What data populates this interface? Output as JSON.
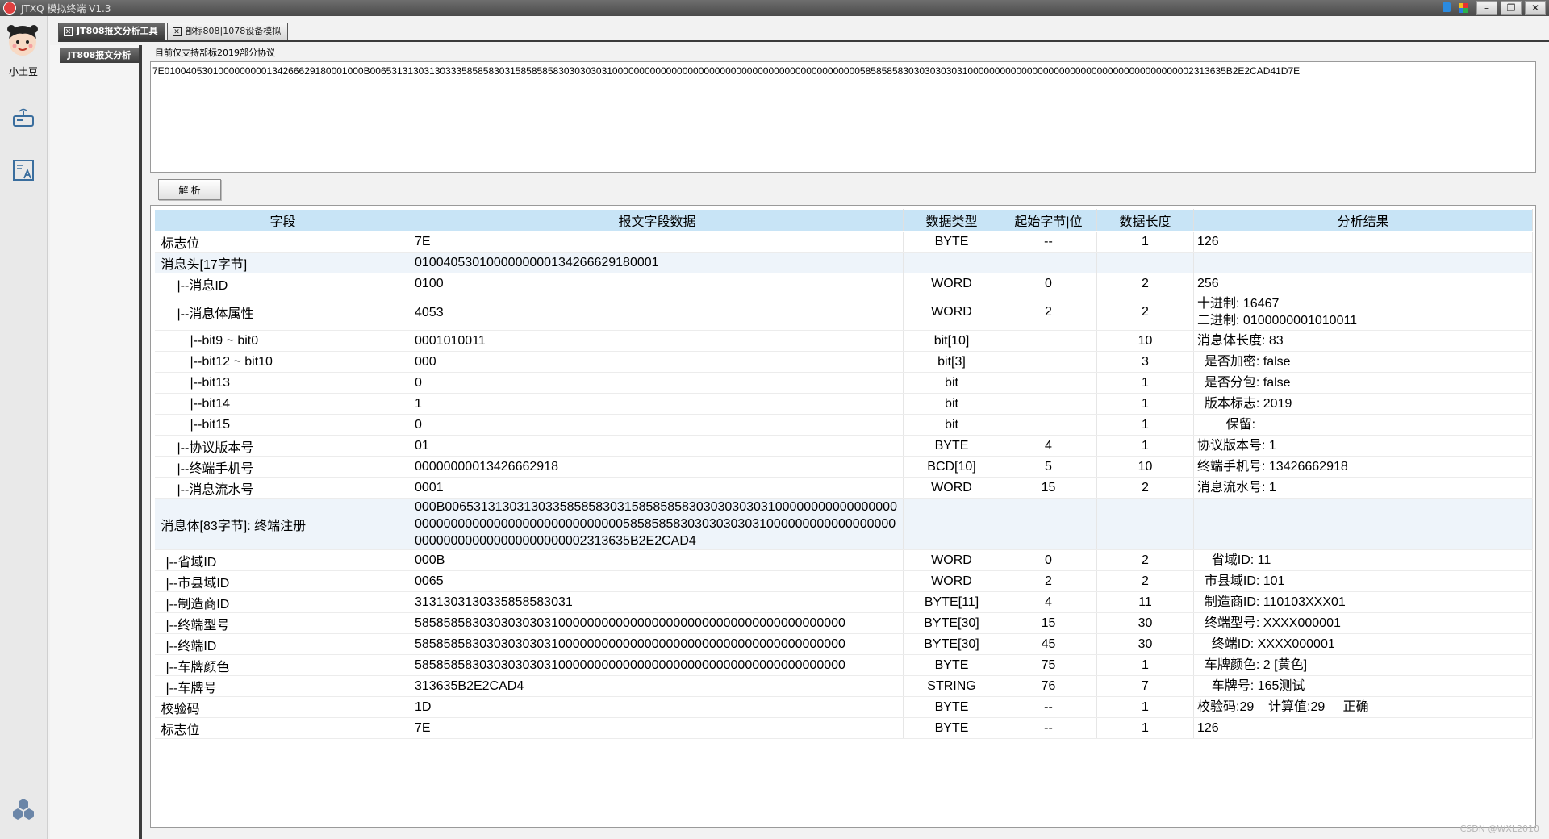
{
  "window": {
    "title": "JTXQ 模拟终端 V1.3",
    "buttons": [
      "–",
      "❐",
      "✕"
    ]
  },
  "leftnav": {
    "avatar_name": "小土豆"
  },
  "tabs": [
    {
      "label": "JT808报文分析工具",
      "active": true
    },
    {
      "label": "部标808|1078设备模拟",
      "active": false
    }
  ],
  "subpanel": {
    "tab_label": "JT808报文分析"
  },
  "main": {
    "hint": "目前仅支持部标2019部分协议",
    "hex_input": "7E0100405301000000000134266629180001000B006531313031303335858583031585858583030303031000000000000000000000000000000000000000000000058585858303030303031000000000000000000000000000000000000000002313635B2E2CAD41D7E",
    "parse_button": "解  析"
  },
  "table": {
    "headers": [
      "字段",
      "报文字段数据",
      "数据类型",
      "起始字节|位",
      "数据长度",
      "分析结果"
    ],
    "rows": [
      {
        "field": "标志位",
        "data": "7E",
        "type": "BYTE",
        "start": "--",
        "len": "1",
        "result": [
          "126"
        ]
      },
      {
        "field": "消息头[17字节]",
        "data": "010040530100000000013426662918000​1",
        "type": "",
        "start": "",
        "len": "",
        "result": [],
        "section": true
      },
      {
        "field": "|--消息ID",
        "data": "0100",
        "type": "WORD",
        "start": "0",
        "len": "2",
        "result": [
          "256"
        ],
        "indent": 1
      },
      {
        "field": "|--消息体属性",
        "data": "4053",
        "type": "WORD",
        "start": "2",
        "len": "2",
        "result": [
          "十进制: 16467",
          "二进制: 0100000001010011"
        ],
        "indent": 1,
        "tall": true
      },
      {
        "field": "|--bit9 ~ bit0",
        "data": "0001010011",
        "type": "bit[10]",
        "start": "",
        "len": "10",
        "result": [
          "消息体长度: 83"
        ],
        "indent": 2
      },
      {
        "field": "|--bit12 ~ bit10",
        "data": "000",
        "type": "bit[3]",
        "start": "",
        "len": "3",
        "result": [
          "  是否加密: false"
        ],
        "indent": 2
      },
      {
        "field": "|--bit13",
        "data": "0",
        "type": "bit",
        "start": "",
        "len": "1",
        "result": [
          "  是否分包: false"
        ],
        "indent": 2
      },
      {
        "field": "|--bit14",
        "data": "1",
        "type": "bit",
        "start": "",
        "len": "1",
        "result": [
          "  版本标志: 2019"
        ],
        "indent": 2
      },
      {
        "field": "|--bit15",
        "data": "0",
        "type": "bit",
        "start": "",
        "len": "1",
        "result": [
          "        保留:"
        ],
        "indent": 2
      },
      {
        "field": "|--协议版本号",
        "data": "01",
        "type": "BYTE",
        "start": "4",
        "len": "1",
        "result": [
          "协议版本号: 1"
        ],
        "indent": 1
      },
      {
        "field": "|--终端手机号",
        "data": "00000000013426662918",
        "type": "BCD[10]",
        "start": "5",
        "len": "10",
        "result": [
          "终端手机号: 13426662918"
        ],
        "indent": 1
      },
      {
        "field": "|--消息流水号",
        "data": "0001",
        "type": "WORD",
        "start": "15",
        "len": "2",
        "result": [
          "消息流水号: 1"
        ],
        "indent": 1
      },
      {
        "field": "消息体[83字节]: 终端注册",
        "data": "000B0065313130313033585858303158585858303030303031000000000000000000000000000000000000000000000058585858303030303031000000000000000000000000000000000000000002313635B2E2CAD4",
        "type": "",
        "start": "",
        "len": "",
        "result": [],
        "section": true,
        "tall": true
      },
      {
        "field": "|--省域ID",
        "data": "000B",
        "type": "WORD",
        "start": "0",
        "len": "2",
        "result": [
          "    省域ID: 11"
        ],
        "indent": 0
      },
      {
        "field": "|--市县域ID",
        "data": "0065",
        "type": "WORD",
        "start": "2",
        "len": "2",
        "result": [
          "  市县域ID: 101"
        ],
        "indent": 0
      },
      {
        "field": "|--制造商ID",
        "data": "3131303130335858583031",
        "type": "BYTE[11]",
        "start": "4",
        "len": "11",
        "result": [
          "  制造商ID: 110103XXX01"
        ],
        "indent": 0
      },
      {
        "field": "|--终端型号",
        "data": "585858583030303030310000000000000000000000000000000000000000",
        "type": "BYTE[30]",
        "start": "15",
        "len": "30",
        "result": [
          "  终端型号: XXXX000001"
        ],
        "indent": 0
      },
      {
        "field": "|--终端ID",
        "data": "585858583030303030310000000000000000000000000000000000000000",
        "type": "BYTE[30]",
        "start": "45",
        "len": "30",
        "result": [
          "    终端ID: XXXX000001"
        ],
        "indent": 0
      },
      {
        "field": "|--车牌颜色",
        "data": "585858583030303030310000000000000000000000000000000000000000",
        "type": "BYTE",
        "start": "75",
        "len": "1",
        "result": [
          "  车牌颜色: 2 [黄色]"
        ],
        "indent": 0
      },
      {
        "field": "|--车牌号",
        "data": "313635B2E2CAD4",
        "type": "STRING",
        "start": "76",
        "len": "7",
        "result": [
          "    车牌号: 165测试"
        ],
        "indent": 0
      },
      {
        "field": "校验码",
        "data": "1D",
        "type": "BYTE",
        "start": "--",
        "len": "1",
        "result": [
          "校验码:29    计算值:29     正确"
        ]
      },
      {
        "field": "标志位",
        "data": "7E",
        "type": "BYTE",
        "start": "--",
        "len": "1",
        "result": [
          "126"
        ]
      }
    ]
  },
  "watermark": "CSDN @WXL2010"
}
